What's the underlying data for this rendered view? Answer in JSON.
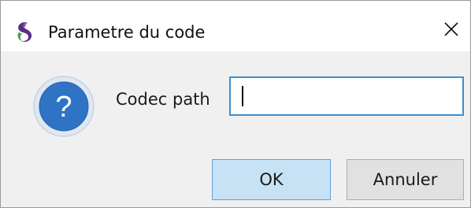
{
  "window": {
    "title": "Parametre du code",
    "app_icon": "mascot-icon",
    "close_icon": "close-icon"
  },
  "dialog": {
    "icon": "question-icon",
    "icon_glyph": "?",
    "field_label": "Codec path",
    "field_value": "",
    "field_placeholder": ""
  },
  "buttons": {
    "ok_label": "OK",
    "cancel_label": "Annuler"
  },
  "colors": {
    "focus_border": "#3c8fd0",
    "ok_bg": "#c8e2f5",
    "question_circle": "#2f73c4"
  }
}
